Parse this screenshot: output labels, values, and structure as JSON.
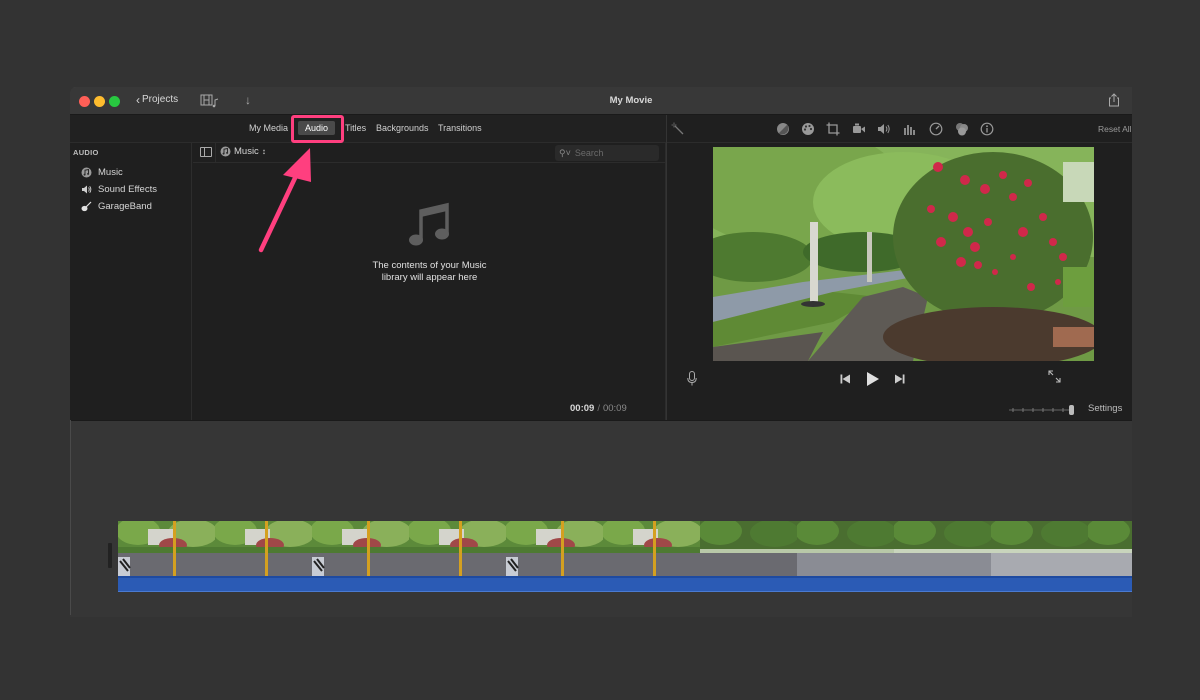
{
  "window": {
    "title": "My Movie",
    "projects_label": "Projects"
  },
  "browser": {
    "tabs": [
      {
        "label": "My Media",
        "active": false
      },
      {
        "label": "Audio",
        "active": true
      },
      {
        "label": "Titles",
        "active": false
      },
      {
        "label": "Backgrounds",
        "active": false
      },
      {
        "label": "Transitions",
        "active": false
      }
    ],
    "sidebar": {
      "header": "AUDIO",
      "items": [
        {
          "label": "Music",
          "icon": "music-circle-icon"
        },
        {
          "label": "Sound Effects",
          "icon": "speaker-icon"
        },
        {
          "label": "GarageBand",
          "icon": "guitar-icon"
        }
      ]
    },
    "source_select": {
      "value": "Music"
    },
    "search": {
      "placeholder": "Search",
      "value": ""
    },
    "empty_state": {
      "line1": "The contents of your Music",
      "line2": "library will appear here"
    }
  },
  "timecode": {
    "current": "00:09",
    "separator": "/",
    "total": "00:09"
  },
  "viewer": {
    "toolbar_icons": [
      "magic-wand-icon",
      "color-balance-icon",
      "color-correction-icon",
      "crop-icon",
      "stabilization-icon",
      "volume-icon",
      "equalizer-icon",
      "speed-icon",
      "clip-filter-icon",
      "info-icon"
    ],
    "reset_all_label": "Reset All",
    "settings_label": "Settings",
    "zoom_level": 1.0
  },
  "annotation": {
    "highlight_color": "#ff3f7f",
    "target": "Audio"
  },
  "timeline": {
    "clip_frames": 11,
    "audio_color": "#2b5bb5"
  }
}
